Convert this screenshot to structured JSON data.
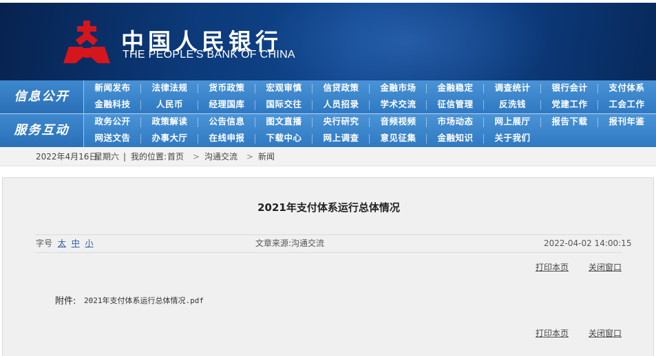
{
  "header": {
    "logo_cn": "中国人民银行",
    "logo_en": "THE PEOPLE'S BANK OF CHINA",
    "top_strip_text": "…",
    "colors": {
      "banner": "#0c3a7a",
      "logo_red": "#d7151c"
    }
  },
  "nav": {
    "groups": [
      {
        "title": "信息公开",
        "rows": [
          [
            "新闻发布",
            "法律法规",
            "货币政策",
            "宏观审慎",
            "信贷政策",
            "金融市场",
            "金融稳定",
            "调查统计",
            "银行会计",
            "支付体系"
          ],
          [
            "金融科技",
            "人民币",
            "经理国库",
            "国际交往",
            "人员招录",
            "学术交流",
            "征信管理",
            "反洗钱",
            "党建工作",
            "工会工作"
          ]
        ]
      },
      {
        "title": "服务互动",
        "rows": [
          [
            "政务公开",
            "政策解读",
            "公告信息",
            "图文直播",
            "央行研究",
            "音频视频",
            "市场动态",
            "网上展厅",
            "报告下载",
            "报刊年鉴"
          ],
          [
            "网送文告",
            "办事大厅",
            "在线申报",
            "下载中心",
            "网上调查",
            "意见征集",
            "金融知识",
            "关于我们"
          ]
        ]
      }
    ]
  },
  "breadcrumb": {
    "date": "2022年4月16日",
    "weekday": "星期六",
    "divider": "|",
    "location_label": "我的位置:",
    "home": "首页",
    "sep": ">",
    "level1": "沟通交流",
    "level2": "新闻"
  },
  "article": {
    "title": "2021年支付体系运行总体情况",
    "font_size_label": "字号",
    "font_sizes": [
      "太",
      "中",
      "小"
    ],
    "source_label": "文章来源:",
    "source": "沟通交流",
    "datetime": "2022-04-02 14:00:15",
    "print_label": "打印本页",
    "close_label": "关闭窗口",
    "attachment_label": "附件:",
    "attachment_file": "2021年支付体系运行总体情况.pdf"
  }
}
